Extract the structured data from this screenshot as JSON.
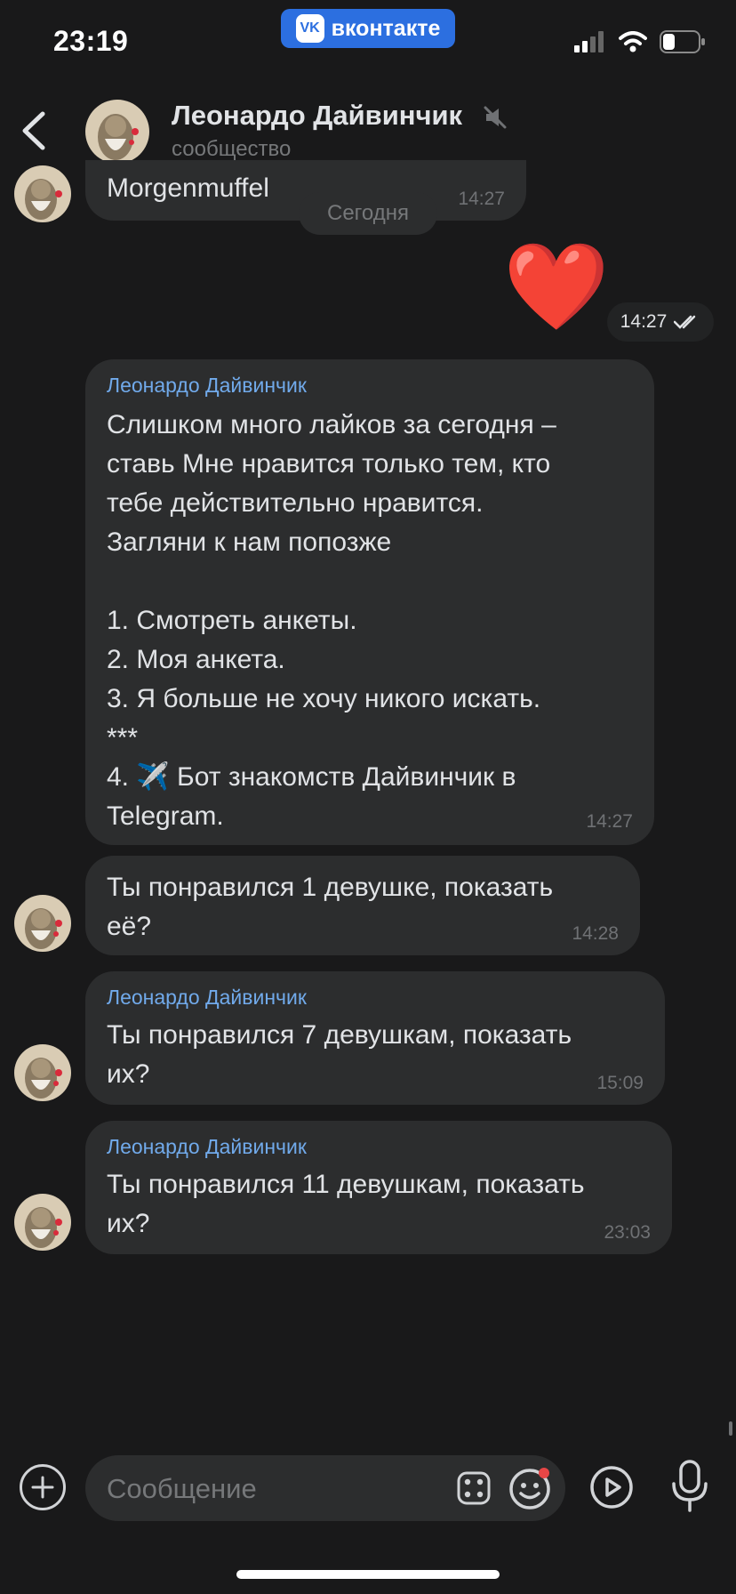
{
  "status_bar": {
    "time": "23:19",
    "vk_badge": "вконтакте",
    "vk_logo": "VK"
  },
  "header": {
    "name": "Леонардо Дайвинчик",
    "subtitle": "сообщество"
  },
  "date_divider": "Сегодня",
  "prev_message": {
    "text": "Morgenmuffel",
    "time": "14:27"
  },
  "outgoing": {
    "emoji": "❤️",
    "time": "14:27"
  },
  "messages": [
    {
      "sender": "Леонардо Дайвинчик",
      "lines": [
        "Слишком много лайков за сегодня –",
        "ставь Мне нравится только тем, кто",
        "тебе действительно нравится.",
        "Загляни к нам попозже",
        "",
        "1. Смотреть анкеты.",
        "2. Моя анкета.",
        "3. Я больше не хочу никого искать.",
        "***",
        "4. ✈️ Бот знакомств Дайвинчик в",
        "Telegram."
      ],
      "time": "14:27"
    },
    {
      "lines": [
        "Ты понравился 1 девушке, показать",
        "её?"
      ],
      "time": "14:28"
    },
    {
      "sender": "Леонардо Дайвинчик",
      "lines": [
        "Ты понравился 7 девушкам, показать",
        "их?"
      ],
      "time": "15:09"
    },
    {
      "sender": "Леонардо Дайвинчик",
      "lines": [
        "Ты понравился 11 девушкам, показать",
        "их?"
      ],
      "time": "23:03"
    }
  ],
  "input": {
    "placeholder": "Сообщение"
  },
  "icons": {
    "back": "chevron-left-icon",
    "mute": "speaker-muted-icon",
    "plus": "plus-circle-icon",
    "stickers": "dice-icon",
    "emoji": "smiley-icon",
    "video": "play-circle-icon",
    "mic": "microphone-icon"
  },
  "colors": {
    "accent": "#71aaeb",
    "brand": "#2c6fe0",
    "background": "#19191a",
    "bubble": "#2c2d2e",
    "notification": "#e64646"
  }
}
